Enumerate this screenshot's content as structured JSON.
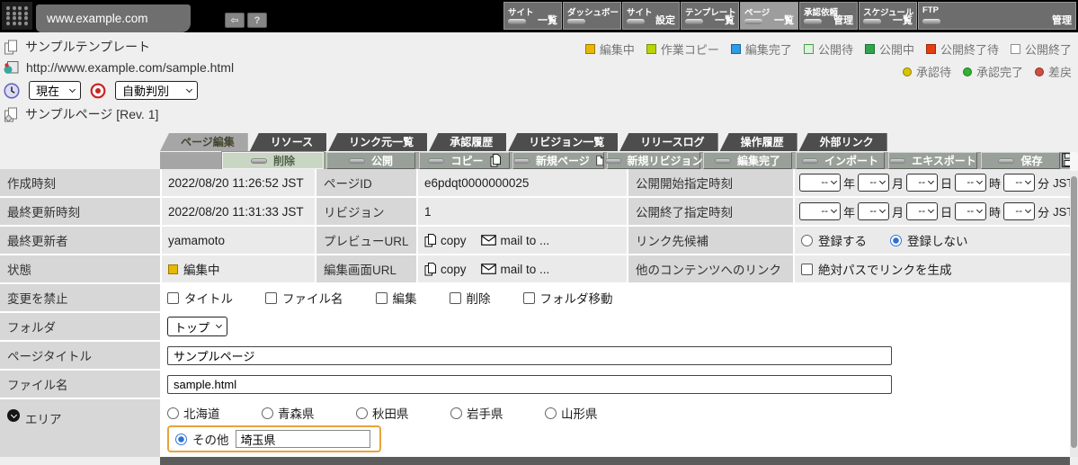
{
  "topbar": {
    "site_tab": "www.example.com",
    "back_glyph": "⇦",
    "help_glyph": "?",
    "nav": [
      {
        "top": "サイト",
        "bottom": "一覧"
      },
      {
        "top": "ダッシュボード",
        "bottom": ""
      },
      {
        "top": "サイト",
        "bottom": "設定"
      },
      {
        "top": "テンプレート",
        "bottom": "一覧"
      },
      {
        "top": "ページ",
        "bottom": "一覧"
      },
      {
        "top": "承認依頼",
        "bottom": "管理"
      },
      {
        "top": "スケジュール",
        "bottom": "一覧"
      },
      {
        "top": "FTP",
        "bottom": "管理"
      }
    ]
  },
  "header": {
    "template_name": "サンプルテンプレート",
    "url": "http://www.example.com/sample.html",
    "revision_select": "現在",
    "mode_select": "自動判別",
    "page_name": "サンプルページ [Rev. 1]",
    "status_legend": [
      {
        "label": "編集中",
        "color": "#e8b800",
        "border": "#9a7a00"
      },
      {
        "label": "作業コピー",
        "color": "#b9d400",
        "border": "#7a8f00"
      },
      {
        "label": "編集完了",
        "color": "#2e9be3",
        "border": "#1565a0"
      },
      {
        "label": "公開待",
        "color": "#ddf2dd",
        "border": "#4aa04a"
      },
      {
        "label": "公開中",
        "color": "#2fa54d",
        "border": "#1d7334"
      },
      {
        "label": "公開終了待",
        "color": "#e63c0f",
        "border": "#9c2a0a"
      },
      {
        "label": "公開終了",
        "color": "#ffffff",
        "border": "#8f8f8f"
      }
    ],
    "approval_legend": [
      {
        "label": "承認待",
        "color": "#d9c400",
        "border": "#8f8200"
      },
      {
        "label": "承認完了",
        "color": "#33b133",
        "border": "#1f7a1f"
      },
      {
        "label": "差戻",
        "color": "#cf4e43",
        "border": "#8f2f28"
      }
    ]
  },
  "tabs": [
    {
      "label": "ページ編集"
    },
    {
      "label": "リソース"
    },
    {
      "label": "リンク元一覧"
    },
    {
      "label": "承認履歴"
    },
    {
      "label": "リビジョン一覧"
    },
    {
      "label": "リリースログ"
    },
    {
      "label": "操作履歴"
    },
    {
      "label": "外部リンク"
    }
  ],
  "toolbar": [
    {
      "label": "削除"
    },
    {
      "label": "公開"
    },
    {
      "label": "コピー"
    },
    {
      "label": "新規ページ"
    },
    {
      "label": "新規リビジョン"
    },
    {
      "label": "編集完了"
    },
    {
      "label": "インポート"
    },
    {
      "label": "エキスポート"
    },
    {
      "label": "保存"
    }
  ],
  "form": {
    "created_label": "作成時刻",
    "created_value": "2022/08/20 11:26:52 JST",
    "page_id_label": "ページID",
    "page_id_value": "e6pdqt0000000025",
    "publish_start_label": "公開開始指定時刻",
    "updated_label": "最終更新時刻",
    "updated_value": "2022/08/20 11:31:33 JST",
    "revision_label": "リビジョン",
    "revision_value": "1",
    "publish_end_label": "公開終了指定時刻",
    "updater_label": "最終更新者",
    "updater_value": "yamamoto",
    "preview_url_label": "プレビューURL",
    "edit_url_label": "編集画面URL",
    "copy_link": "copy",
    "mail_link": "mail to ...",
    "link_candidate_label": "リンク先候補",
    "register_yes": "登録する",
    "register_no": "登録しない",
    "status_label": "状態",
    "status_value": "編集中",
    "other_content_label": "他のコンテンツへのリンク",
    "abs_path_label": "絶対パスでリンクを生成",
    "forbid_label": "変更を禁止",
    "forbid_options": [
      {
        "label": "タイトル"
      },
      {
        "label": "ファイル名"
      },
      {
        "label": "編集"
      },
      {
        "label": "削除"
      },
      {
        "label": "フォルダ移動"
      }
    ],
    "folder_label": "フォルダ",
    "folder_value": "トップ",
    "page_title_label": "ページタイトル",
    "page_title_value": "サンプルページ",
    "file_name_label": "ファイル名",
    "file_name_value": "sample.html",
    "area_label": "エリア",
    "area_options": [
      {
        "label": "北海道"
      },
      {
        "label": "青森県"
      },
      {
        "label": "秋田県"
      },
      {
        "label": "岩手県"
      },
      {
        "label": "山形県"
      }
    ],
    "area_other_label": "その他",
    "area_other_value": "埼玉県",
    "date": {
      "placeholder": "--",
      "year": "年",
      "month": "月",
      "day": "日",
      "hour": "時",
      "minute": "分",
      "tz": "JST"
    }
  }
}
